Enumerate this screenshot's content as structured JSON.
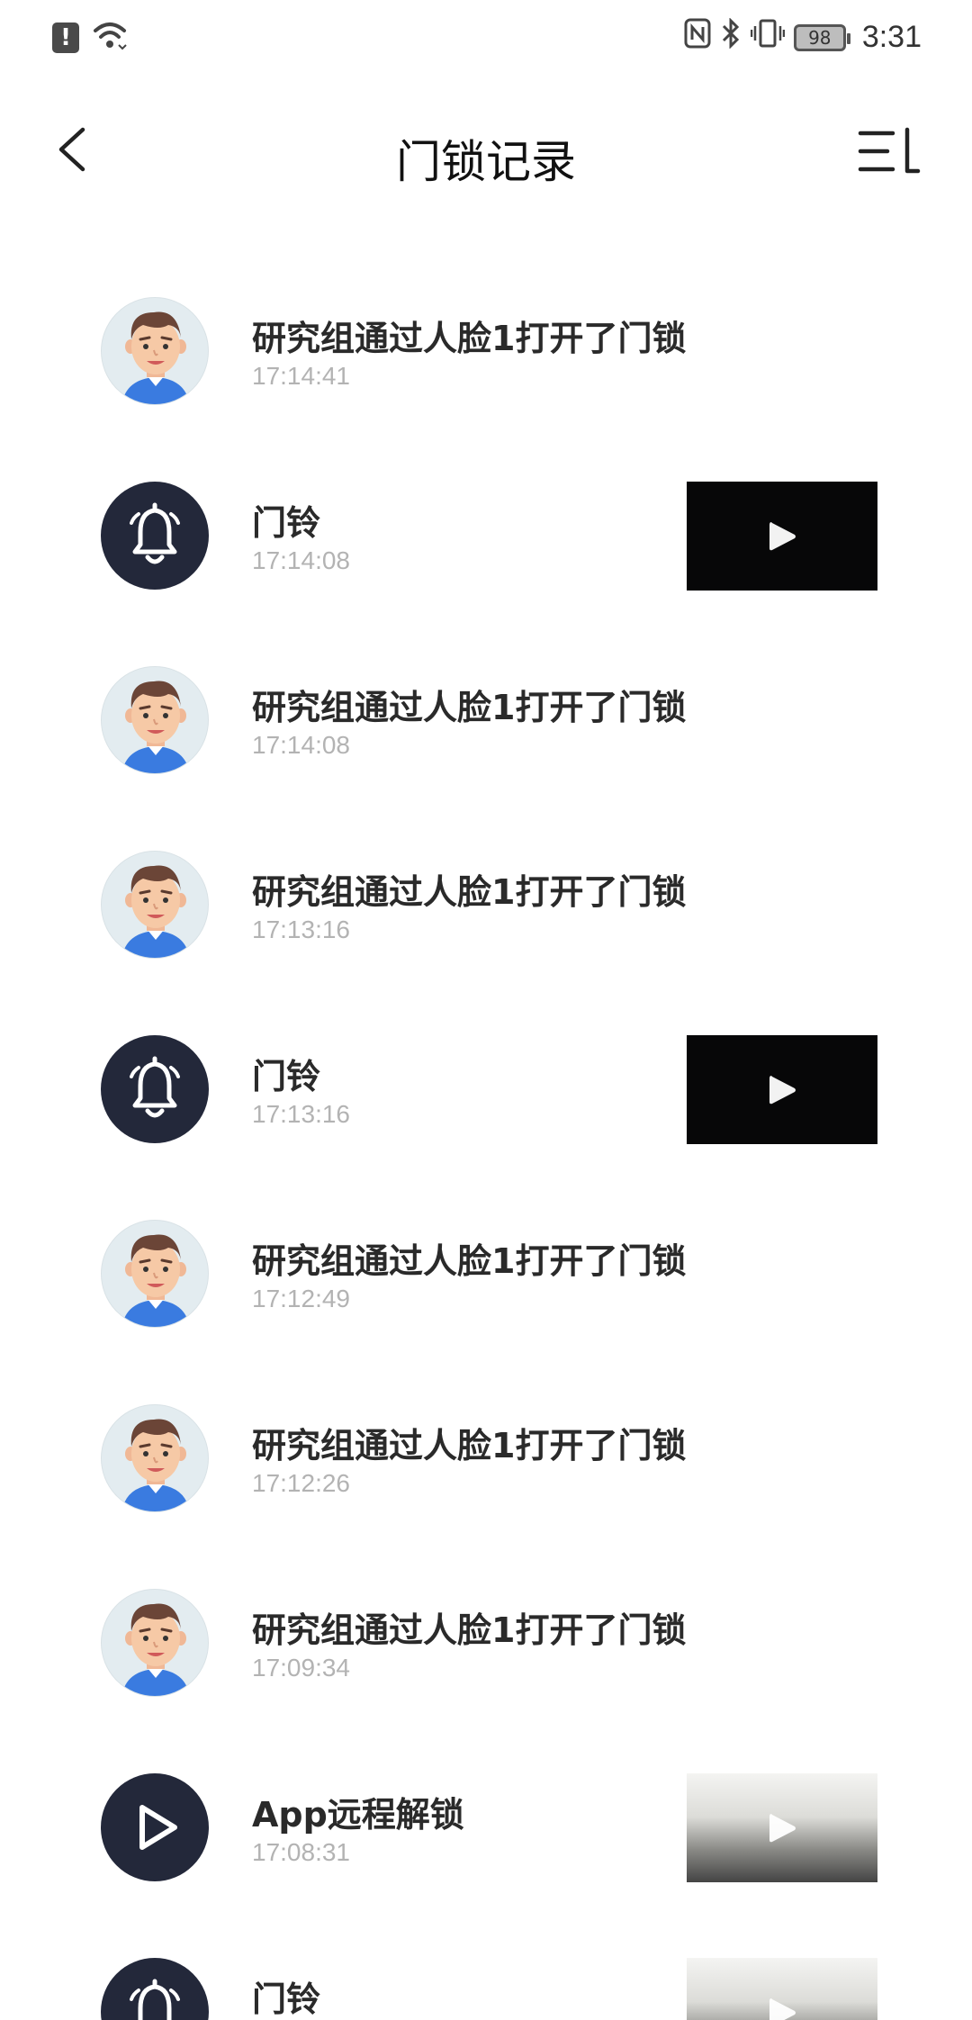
{
  "status_bar": {
    "alert_glyph": "!",
    "battery": "98",
    "time": "3:31",
    "icons": [
      "alert-icon",
      "wifi-icon",
      "nfc-icon",
      "bluetooth-icon",
      "vibrate-icon",
      "battery-icon"
    ]
  },
  "header": {
    "title": "门锁记录",
    "back_icon": "chevron-left-icon",
    "menu_icon": "sort-list-icon"
  },
  "records": [
    {
      "type": "face",
      "title": "研究组通过人脸1打开了门锁",
      "time": "17:14:41"
    },
    {
      "type": "doorbell",
      "title": "门铃",
      "time": "17:14:08",
      "thumbnail": "dark"
    },
    {
      "type": "face",
      "title": "研究组通过人脸1打开了门锁",
      "time": "17:14:08"
    },
    {
      "type": "face",
      "title": "研究组通过人脸1打开了门锁",
      "time": "17:13:16"
    },
    {
      "type": "doorbell",
      "title": "门铃",
      "time": "17:13:16",
      "thumbnail": "dark"
    },
    {
      "type": "face",
      "title": "研究组通过人脸1打开了门锁",
      "time": "17:12:49"
    },
    {
      "type": "face",
      "title": "研究组通过人脸1打开了门锁",
      "time": "17:12:26"
    },
    {
      "type": "face",
      "title": "研究组通过人脸1打开了门锁",
      "time": "17:09:34"
    },
    {
      "type": "remote",
      "title": "App远程解锁",
      "time": "17:08:31",
      "thumbnail": "light"
    },
    {
      "type": "doorbell",
      "title": "门铃",
      "time": "",
      "thumbnail": "light"
    }
  ],
  "colors": {
    "dark_icon_bg": "#23283a",
    "time_text": "#b3b3b3",
    "title_text": "#2a2a2a",
    "shirt": "#3a7be0"
  }
}
